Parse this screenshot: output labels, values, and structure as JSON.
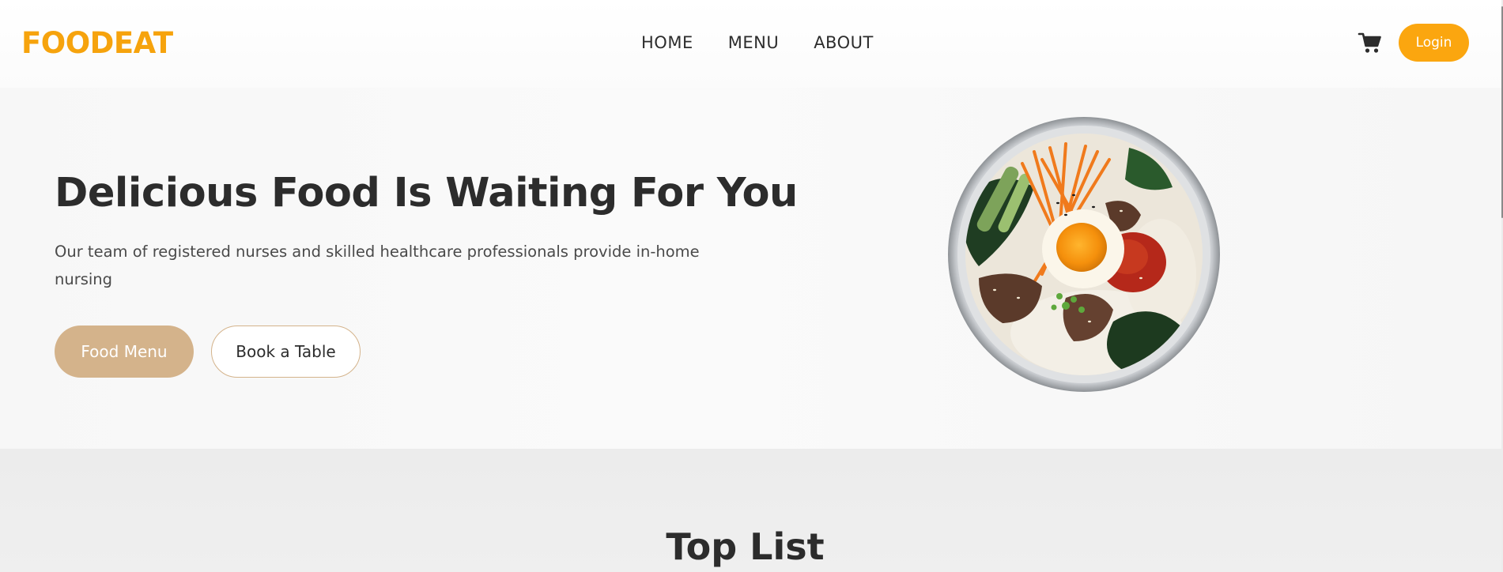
{
  "header": {
    "brand": "FOODEAT",
    "nav": [
      {
        "label": "HOME"
      },
      {
        "label": "MENU"
      },
      {
        "label": "ABOUT"
      }
    ],
    "cart_icon": "shopping-cart-icon",
    "login_label": "Login"
  },
  "hero": {
    "title": "Delicious Food Is Waiting For You",
    "description": "Our team of registered nurses and skilled healthcare professionals provide in-home nursing",
    "food_menu_label": "Food Menu",
    "book_table_label": "Book a Table"
  },
  "toplist": {
    "title": "Top List"
  },
  "colors": {
    "brand": "#f6a30d",
    "login_button": "#fba60f",
    "primary_button": "#d4b38b",
    "text": "#2c2c2c"
  }
}
